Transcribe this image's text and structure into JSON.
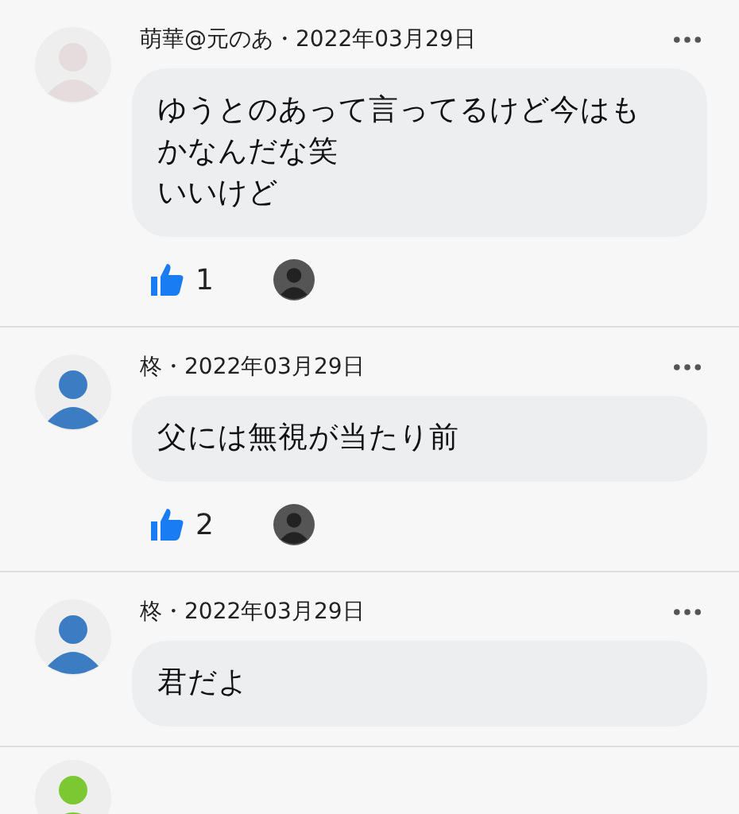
{
  "comments": [
    {
      "kind": "full",
      "color": "#e6dcdd",
      "header": "萌華@元のあ・2022年03月29日",
      "text": [
        "ゆうとのあって言ってるけど今はもかなんだな笑",
        "いいけど"
      ],
      "likes": "1"
    },
    {
      "kind": "full",
      "color": "#3b7cc2",
      "header": "柊・2022年03月29日",
      "text": [
        "父には無視が当たり前"
      ],
      "likes": "2"
    },
    {
      "kind": "full",
      "color": "#3b7cc2",
      "header": "柊・2022年03月29日",
      "text": [
        "君だよ"
      ]
    },
    {
      "kind": "cut",
      "color": "#7cc832"
    }
  ]
}
